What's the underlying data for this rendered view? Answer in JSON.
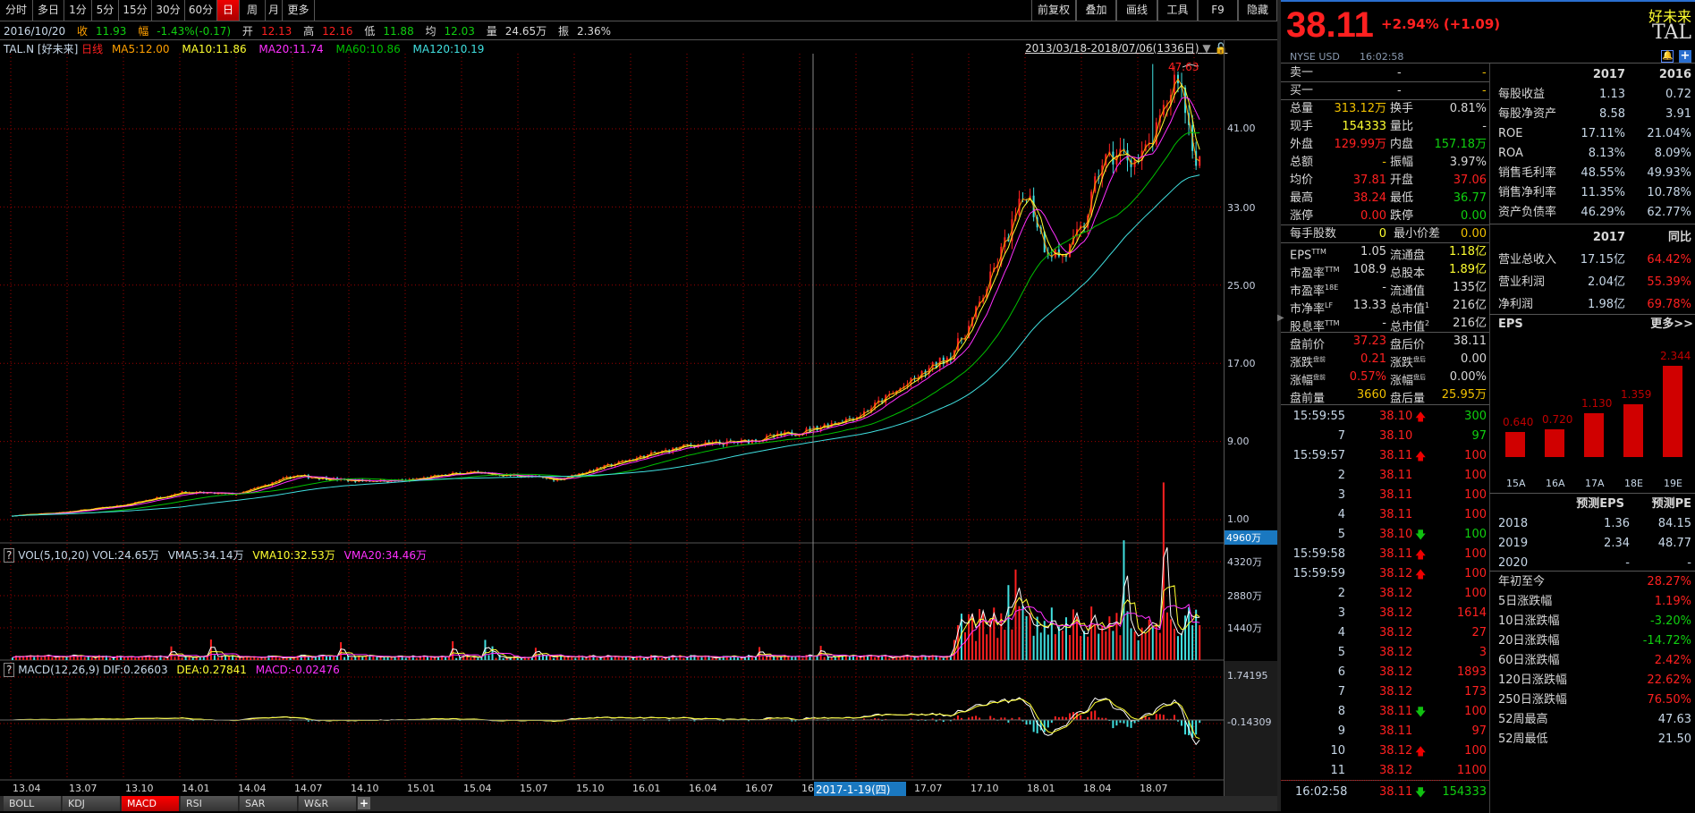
{
  "toolbar": {
    "periods": [
      "分时",
      "多日",
      "1分",
      "5分",
      "15分",
      "30分",
      "60分",
      "日",
      "周",
      "月",
      "更多"
    ],
    "active": "日",
    "right": [
      "前复权",
      "叠加",
      "画线",
      "工具",
      "F9",
      "隐藏"
    ]
  },
  "info": {
    "date": "2016/10/20",
    "close_label": "收",
    "close": "11.93",
    "chg_label": "幅",
    "chg": "-1.43%(-0.17)",
    "open_label": "开",
    "open": "12.13",
    "high_label": "高",
    "high": "12.16",
    "low_label": "低",
    "low": "11.88",
    "avg_label": "均",
    "avg": "12.03",
    "vol_label": "量",
    "vol": "24.65万",
    "amp_label": "振",
    "amp": "2.36%"
  },
  "ma_line": {
    "symbol": "TAL.N [好未来]",
    "period": "日线",
    "ma5": "MA5:12.00",
    "ma10": "MA10:11.86",
    "ma20": "MA20:11.74",
    "ma60": "MA60:10.86",
    "ma120": "MA120:10.19"
  },
  "range_label": "2013/03/18-2018/07/06(1336日)",
  "high_marker": "47.63",
  "price_axis": [
    "41.00",
    "33.00",
    "25.00",
    "17.00",
    "9.00",
    "1.00"
  ],
  "price_axis_values": [
    41,
    33,
    25,
    17,
    9,
    1
  ],
  "vol_cursor": "4960万",
  "vol_line": {
    "help": "?",
    "name": "VOL(5,10,20)",
    "vol": "VOL:24.65万",
    "vma5": "VMA5:34.14万",
    "vma10": "VMA10:32.53万",
    "vma20": "VMA20:34.46万"
  },
  "vol_axis": [
    "4320万",
    "2880万",
    "1440万"
  ],
  "macd_line": {
    "help": "?",
    "name": "MACD(12,26,9)",
    "dif": "DIF:0.26603",
    "dea": "DEA:0.27841",
    "macd": "MACD:-0.02476"
  },
  "macd_axis": [
    "1.74195",
    "-0.14309"
  ],
  "dates": [
    "13.04",
    "13.07",
    "13.10",
    "14.01",
    "14.04",
    "14.07",
    "14.10",
    "15.01",
    "15.04",
    "15.07",
    "15.10",
    "16.01",
    "16.04",
    "16.07",
    "16",
    "17.04",
    "17.07",
    "17.10",
    "18.01",
    "18.04",
    "18.07"
  ],
  "cursor_date": "2017-1-19(四)",
  "indicator_tabs": [
    "BOLL",
    "KDJ",
    "MACD",
    "RSI",
    "SAR",
    "W&R"
  ],
  "active_indicator": "MACD",
  "chart_data": {
    "type": "candlestick",
    "months_from_2013_04": [
      0,
      3,
      6,
      9,
      12,
      15,
      18,
      21,
      24,
      27,
      29,
      30,
      33,
      36,
      39,
      42,
      45,
      48,
      50,
      51,
      52,
      54,
      55,
      56,
      57,
      58,
      59,
      60,
      61,
      62,
      63
    ],
    "closes": [
      1.4,
      1.8,
      2.5,
      3.8,
      3.6,
      5.5,
      5.0,
      5.0,
      5.8,
      5.5,
      5.1,
      5.6,
      7.2,
      8.6,
      9.0,
      10.0,
      11.6,
      15.3,
      18,
      21,
      25.4,
      34.8,
      28.7,
      27.9,
      30.9,
      37.6,
      38.5,
      37.6,
      40.9,
      47,
      38
    ],
    "ylim": [
      1,
      47.63
    ]
  },
  "quote": {
    "price": "38.11",
    "change": "+2.94% (+1.09)",
    "market": "NYSE USD",
    "time": "16:02:58",
    "name_cn": "好未来",
    "ticker": "TAL"
  },
  "book": [
    {
      "label": "卖一",
      "a": "-",
      "b": "-"
    },
    {
      "label": "买一",
      "a": "-",
      "b": "-"
    }
  ],
  "stats": [
    [
      "总量",
      "313.12万",
      "y",
      "换手",
      "0.81%",
      "w"
    ],
    [
      "现手",
      "154333",
      "ye",
      "量比",
      "-",
      "w"
    ],
    [
      "外盘",
      "129.99万",
      "r",
      "内盘",
      "157.18万",
      "g"
    ],
    [
      "总额",
      "-",
      "y",
      "振幅",
      "3.97%",
      "w"
    ],
    [
      "均价",
      "37.81",
      "r",
      "开盘",
      "37.06",
      "r"
    ],
    [
      "最高",
      "38.24",
      "r",
      "最低",
      "36.77",
      "g"
    ],
    [
      "涨停",
      "0.00",
      "r",
      "跌停",
      "0.00",
      "g"
    ]
  ],
  "lot": [
    "每手股数",
    "0",
    "最小价差",
    "0.00"
  ],
  "valuation": [
    [
      "EPS",
      "TTM",
      "1.05",
      "流通盘",
      "",
      "1.18亿",
      "ye"
    ],
    [
      "市盈率",
      "TTM",
      "108.9",
      "总股本",
      "",
      "1.89亿",
      "ye"
    ],
    [
      "市盈率",
      "18E",
      "-",
      "流通值",
      "",
      "135亿",
      "w"
    ],
    [
      "市净率",
      "LF",
      "13.33",
      "总市值",
      "1",
      "216亿",
      "w"
    ],
    [
      "股息率",
      "TTM",
      "-",
      "总市值",
      "2",
      "216亿",
      "w"
    ]
  ],
  "extended": [
    [
      "盘前价",
      "",
      "37.23",
      "r",
      "盘后价",
      "",
      "38.11",
      "w"
    ],
    [
      "涨跌",
      "盘前",
      "0.21",
      "r",
      "涨跌",
      "盘后",
      "0.00",
      "w"
    ],
    [
      "涨幅",
      "盘前",
      "0.57%",
      "r",
      "涨幅",
      "盘后",
      "0.00%",
      "w"
    ],
    [
      "盘前量",
      "",
      "3660",
      "y",
      "盘后量",
      "",
      "25.95万",
      "y"
    ]
  ],
  "trades": [
    [
      "15:59:55",
      "38.10",
      "up",
      "300",
      "g"
    ],
    [
      "7",
      "38.10",
      "",
      "97",
      "g"
    ],
    [
      "15:59:57",
      "38.11",
      "up",
      "100",
      "r"
    ],
    [
      "2",
      "38.11",
      "",
      "100",
      "r"
    ],
    [
      "3",
      "38.11",
      "",
      "100",
      "r"
    ],
    [
      "4",
      "38.11",
      "",
      "100",
      "r"
    ],
    [
      "5",
      "38.10",
      "down",
      "100",
      "g"
    ],
    [
      "15:59:58",
      "38.11",
      "up",
      "100",
      "r"
    ],
    [
      "15:59:59",
      "38.12",
      "up",
      "100",
      "r"
    ],
    [
      "2",
      "38.12",
      "",
      "100",
      "r"
    ],
    [
      "3",
      "38.12",
      "",
      "1614",
      "r"
    ],
    [
      "4",
      "38.12",
      "",
      "27",
      "r"
    ],
    [
      "5",
      "38.12",
      "",
      "3",
      "r"
    ],
    [
      "6",
      "38.12",
      "",
      "1893",
      "r"
    ],
    [
      "7",
      "38.12",
      "",
      "173",
      "r"
    ],
    [
      "8",
      "38.11",
      "down",
      "100",
      "r"
    ],
    [
      "9",
      "38.11",
      "",
      "97",
      "r"
    ],
    [
      "10",
      "38.12",
      "up",
      "100",
      "r"
    ],
    [
      "11",
      "38.12",
      "",
      "1100",
      "r"
    ]
  ],
  "last_trade": [
    "16:02:58",
    "38.11",
    "down",
    "154333"
  ],
  "fin_header": [
    "2017",
    "2016"
  ],
  "fin": [
    [
      "每股收益",
      "1.13",
      "0.72"
    ],
    [
      "每股净资产",
      "8.58",
      "3.91"
    ],
    [
      "ROE",
      "17.11%",
      "21.04%"
    ],
    [
      "ROA",
      "8.13%",
      "8.09%"
    ],
    [
      "销售毛利率",
      "48.55%",
      "49.93%"
    ],
    [
      "销售净利率",
      "11.35%",
      "10.78%"
    ],
    [
      "资产负债率",
      "46.29%",
      "62.77%"
    ]
  ],
  "income_header": [
    "2017",
    "同比"
  ],
  "income": [
    [
      "营业总收入",
      "17.15亿",
      "64.42%"
    ],
    [
      "营业利润",
      "2.04亿",
      "55.39%"
    ],
    [
      "净利润",
      "1.98亿",
      "69.78%"
    ]
  ],
  "eps_title": "EPS",
  "eps_more": "更多>>",
  "eps_bars": [
    {
      "label": "15A",
      "value": 0.64,
      "text": "0.640"
    },
    {
      "label": "16A",
      "value": 0.72,
      "text": "0.720"
    },
    {
      "label": "17A",
      "value": 1.13,
      "text": "1.130"
    },
    {
      "label": "18E",
      "value": 1.359,
      "text": "1.359"
    },
    {
      "label": "19E",
      "value": 2.344,
      "text": "2.344"
    }
  ],
  "forecast_header": [
    "预测EPS",
    "预测PE"
  ],
  "forecast": [
    [
      "2018",
      "1.36",
      "84.15"
    ],
    [
      "2019",
      "2.34",
      "48.77"
    ],
    [
      "2020",
      "-",
      "-"
    ]
  ],
  "perf": [
    [
      "年初至今",
      "28.27%",
      "r"
    ],
    [
      "5日涨跌幅",
      "1.19%",
      "r"
    ],
    [
      "10日涨跌幅",
      "-3.20%",
      "g"
    ],
    [
      "20日涨跌幅",
      "-14.72%",
      "g"
    ],
    [
      "60日涨跌幅",
      "2.42%",
      "r"
    ],
    [
      "120日涨跌幅",
      "22.62%",
      "r"
    ],
    [
      "250日涨跌幅",
      "76.50%",
      "r"
    ],
    [
      "52周最高",
      "47.63",
      "w"
    ],
    [
      "52周最低",
      "21.50",
      "w"
    ]
  ],
  "colors": {
    "up": "#ff2020",
    "down": "#40e0e0",
    "ma5": "#ffa000",
    "ma10": "#ffff30",
    "ma20": "#ff30ff",
    "ma60": "#00c000",
    "ma120": "#40e0e0",
    "grid": "#a00000",
    "accent": "#1a78c0"
  }
}
